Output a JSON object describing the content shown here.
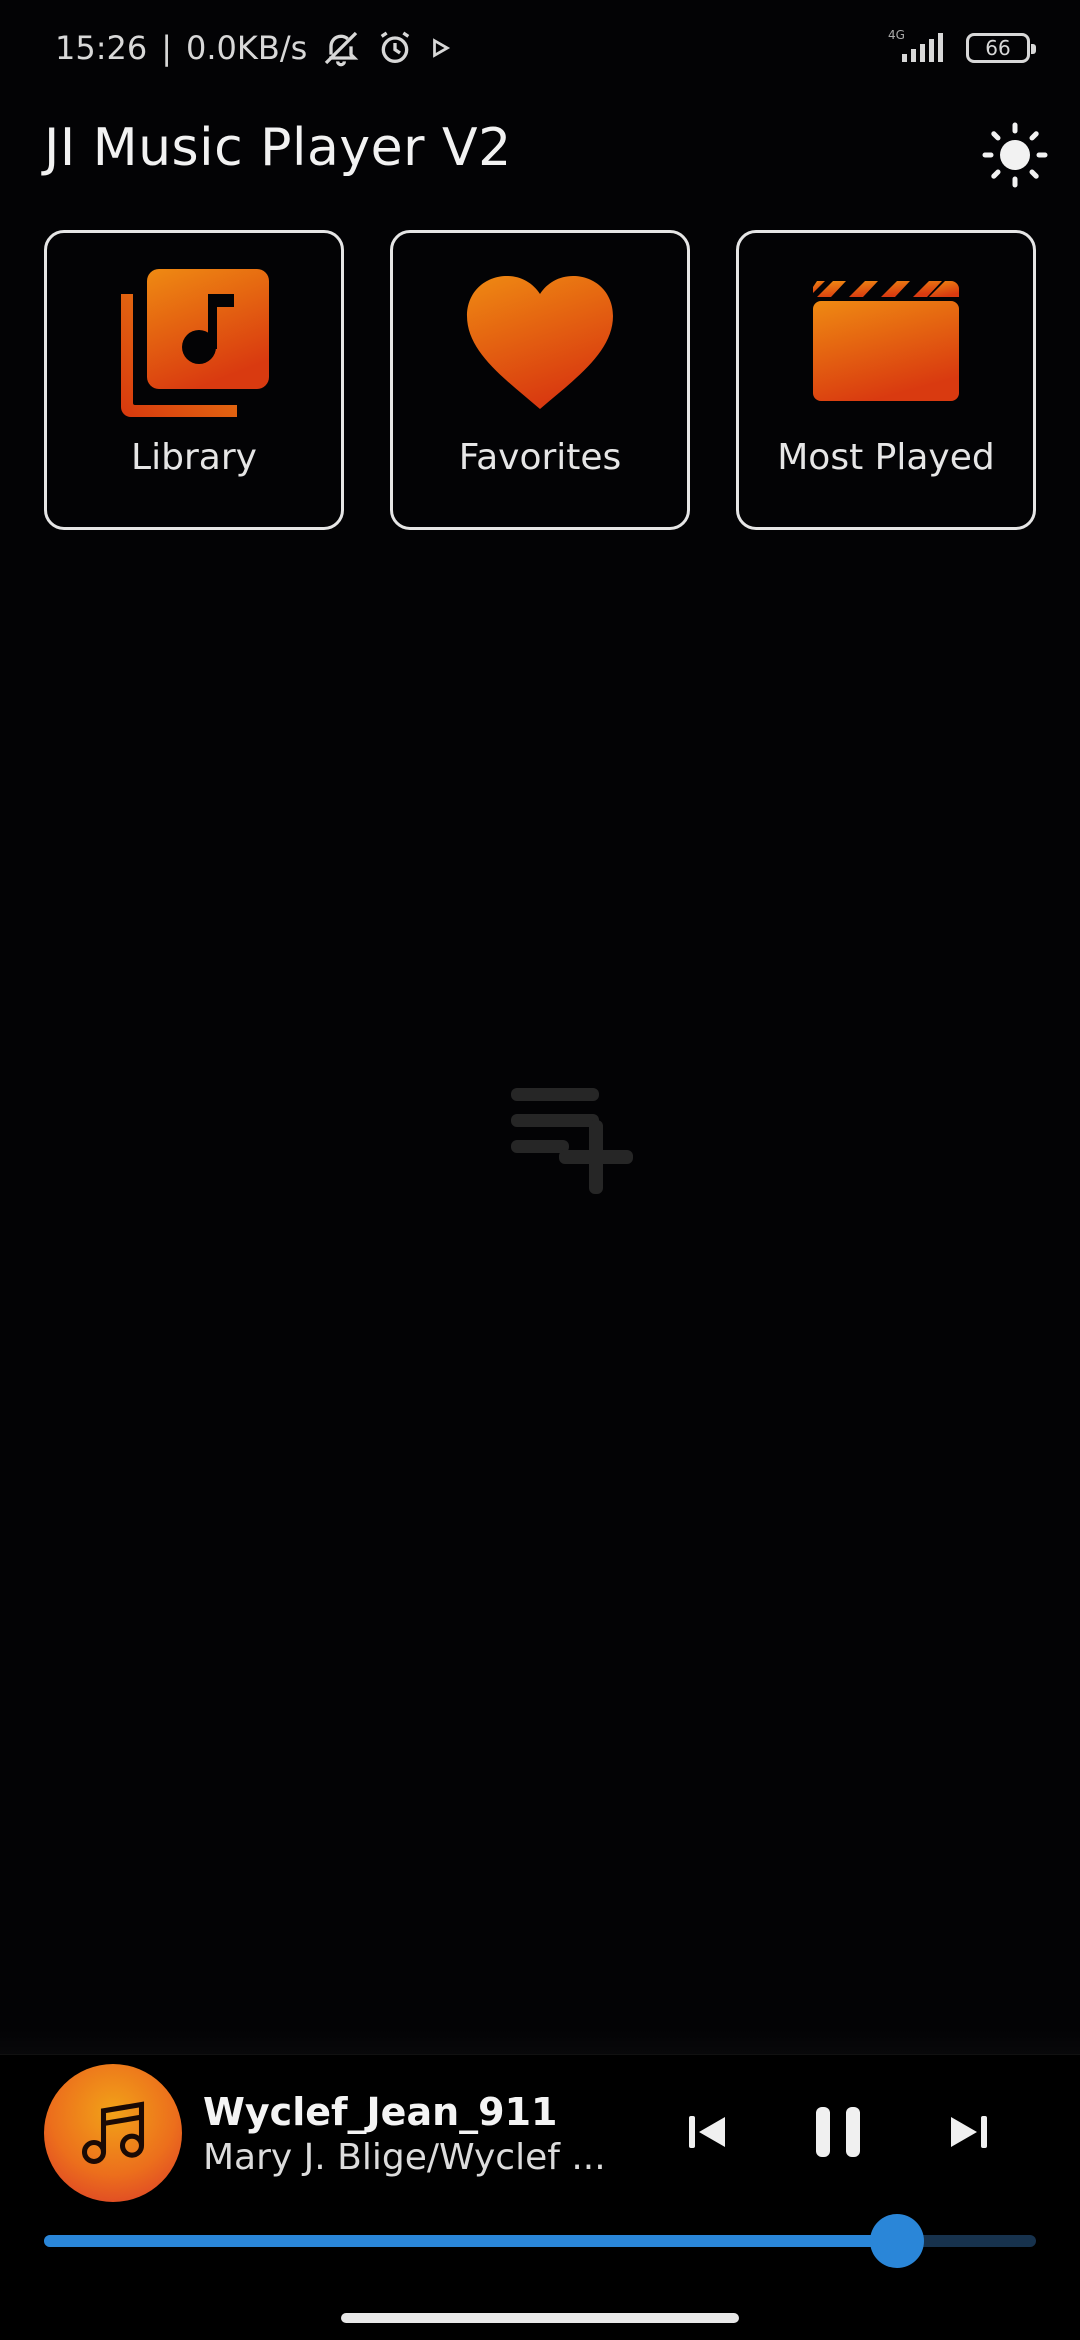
{
  "status_bar": {
    "time": "15:26",
    "network_speed": "0.0KB/s",
    "network_type": "4G",
    "battery_level": "66",
    "icons": [
      "bell-off-icon",
      "alarm-icon",
      "play-indicator-icon",
      "signal-icon",
      "battery-icon"
    ]
  },
  "header": {
    "title": "JI Music Player V2",
    "theme_icon": "sun-icon"
  },
  "tiles": [
    {
      "label": "Library",
      "icon": "library-music-icon"
    },
    {
      "label": "Favorites",
      "icon": "heart-icon"
    },
    {
      "label": "Most Played",
      "icon": "clapperboard-icon"
    }
  ],
  "empty_state": {
    "icon": "playlist-add-icon"
  },
  "now_playing": {
    "title": "Wyclef_Jean_911",
    "artist": "Mary J. Blige/Wyclef ...",
    "progress": 0.86,
    "controls": [
      "skip-previous-icon",
      "pause-icon",
      "skip-next-icon"
    ]
  },
  "colors": {
    "accent_orange": "#ea6a12",
    "progress_blue": "#2a86d8",
    "background": "#030305"
  }
}
